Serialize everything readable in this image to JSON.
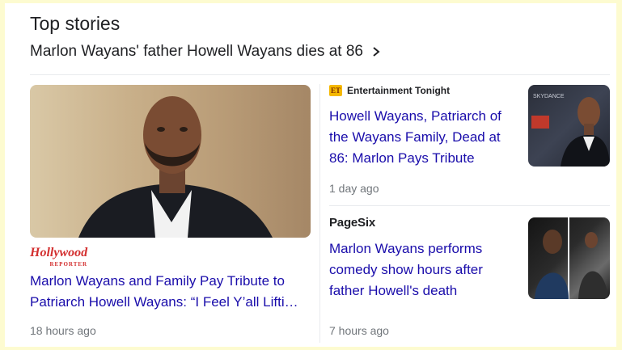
{
  "section": {
    "title": "Top stories"
  },
  "headline": {
    "text": "Marlon Wayans' father Howell Wayans dies at 86",
    "icon": "chevron-right-icon"
  },
  "lead_story": {
    "source_logo_text": "Hollywood",
    "source_logo_sub": "REPORTER",
    "title": "Marlon Wayans and Family Pay Tribute to Patriarch Howell Wayans: “I Feel Y’all Lifti…",
    "time": "18 hours ago"
  },
  "stories": [
    {
      "source": "Entertainment Tonight",
      "source_badge": "ET",
      "title": "Howell Wayans, Patriarch of the Wayans Family, Dead at 86: Marlon Pays Tribute",
      "time": "1 day ago",
      "thumb_text": "SKYDANCE"
    },
    {
      "source": "PageSix",
      "title": "Marlon Wayans performs comedy show hours after father Howell's death",
      "time": "7 hours ago"
    }
  ],
  "colors": {
    "link": "#1a0dab",
    "meta": "#70757a",
    "outer": "#fdfbd0"
  }
}
